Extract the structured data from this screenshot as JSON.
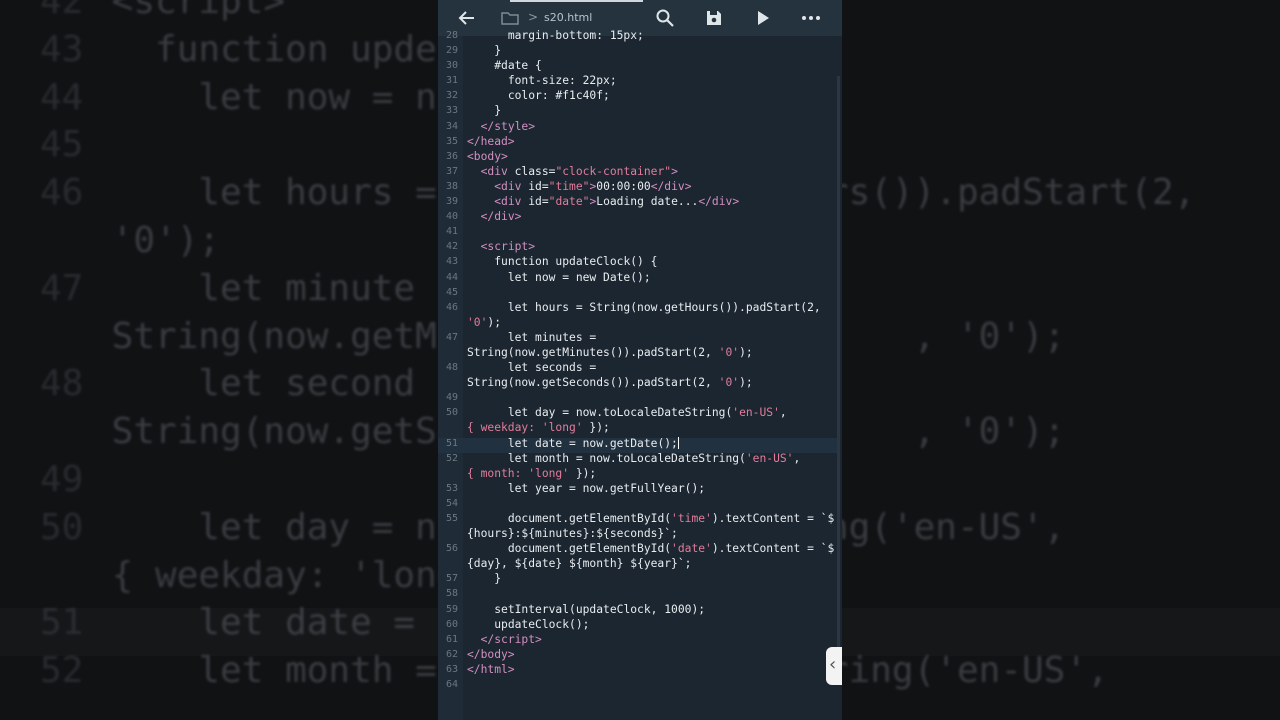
{
  "toolbar": {
    "filename": "s20.html",
    "icons": [
      "back-arrow-icon",
      "folder-icon",
      "search-icon",
      "save-icon",
      "play-icon",
      "more-icon"
    ]
  },
  "editor": {
    "lines": [
      {
        "n": "28",
        "html": "      margin-bottom: 15px;"
      },
      {
        "n": "29",
        "html": "    }"
      },
      {
        "n": "30",
        "html": "    #date {"
      },
      {
        "n": "31",
        "html": "      font-size: 22px;"
      },
      {
        "n": "32",
        "html": "      color: #f1c40f;"
      },
      {
        "n": "33",
        "html": "    }"
      },
      {
        "n": "34",
        "html": "  <span class='c-tag'>&lt;/style&gt;</span>"
      },
      {
        "n": "35",
        "html": "<span class='c-tag'>&lt;/head&gt;</span>"
      },
      {
        "n": "36",
        "html": "<span class='c-tag'>&lt;body&gt;</span>"
      },
      {
        "n": "37",
        "html": "  <span class='c-tag'>&lt;div</span> class=<span class='c-str'>\"clock-container\"</span><span class='c-tag'>&gt;</span>"
      },
      {
        "n": "38",
        "html": "    <span class='c-tag'>&lt;div</span> id=<span class='c-str'>\"time\"</span><span class='c-tag'>&gt;</span>00:00:00<span class='c-tag'>&lt;/div&gt;</span>"
      },
      {
        "n": "39",
        "html": "    <span class='c-tag'>&lt;div</span> id=<span class='c-str'>\"date\"</span><span class='c-tag'>&gt;</span>Loading date...<span class='c-tag'>&lt;/div&gt;</span>"
      },
      {
        "n": "40",
        "html": "  <span class='c-tag'>&lt;/div&gt;</span>"
      },
      {
        "n": "41",
        "html": ""
      },
      {
        "n": "42",
        "html": "  <span class='c-tag'>&lt;script&gt;</span>"
      },
      {
        "n": "43",
        "html": "    function updateClock() {"
      },
      {
        "n": "44",
        "html": "      let now = new Date();"
      },
      {
        "n": "45",
        "html": ""
      },
      {
        "n": "46",
        "tall": true,
        "html": "      let hours = String(now.getHours()).padStart(2,\n<span class='c-str'>'0'</span>);"
      },
      {
        "n": "47",
        "tall": true,
        "html": "      let minutes =\nString(now.getMinutes()).padStart(2, <span class='c-str'>'0'</span>);"
      },
      {
        "n": "48",
        "tall": true,
        "html": "      let seconds =\nString(now.getSeconds()).padStart(2, <span class='c-str'>'0'</span>);"
      },
      {
        "n": "49",
        "html": ""
      },
      {
        "n": "50",
        "tall": true,
        "html": "      let day = now.toLocaleDateString(<span class='c-str'>'en-US'</span>,\n<span class='c-str'>{ weekday: 'long'</span> });"
      },
      {
        "n": "51",
        "html": "      let date = now.getDate();<span class='cursor'></span>"
      },
      {
        "n": "52",
        "tall": true,
        "html": "      let month = now.toLocaleDateString(<span class='c-str'>'en-US'</span>,\n<span class='c-str'>{ month: 'long'</span> });"
      },
      {
        "n": "53",
        "html": "      let year = now.getFullYear();"
      },
      {
        "n": "54",
        "html": ""
      },
      {
        "n": "55",
        "tall": true,
        "html": "      document.getElementById(<span class='c-str'>'time'</span>).textContent = `$\n{hours}:${minutes}:${seconds}`;"
      },
      {
        "n": "56",
        "tall": true,
        "html": "      document.getElementById(<span class='c-str'>'date'</span>).textContent = `$\n{day}, ${date} ${month} ${year}`;"
      },
      {
        "n": "57",
        "html": "    }"
      },
      {
        "n": "58",
        "html": ""
      },
      {
        "n": "59",
        "html": "    setInterval(updateClock, 1000);"
      },
      {
        "n": "60",
        "html": "    updateClock();"
      },
      {
        "n": "61",
        "html": "  <span class='c-tag'>&lt;/script&gt;</span>"
      },
      {
        "n": "62",
        "html": "<span class='c-tag'>&lt;/body&gt;</span>"
      },
      {
        "n": "63",
        "html": "<span class='c-tag'>&lt;/html&gt;</span>"
      },
      {
        "n": "64",
        "html": ""
      }
    ]
  },
  "background": {
    "lines": [
      {
        "n": "42",
        "t": "<script>"
      },
      {
        "n": "43",
        "t": "  function upde"
      },
      {
        "n": "44",
        "t": "    let now = n"
      },
      {
        "n": "45",
        "t": ""
      },
      {
        "n": "46",
        "t": "    let hours =                  rs()).padStart(2,"
      },
      {
        "n": "",
        "t": "'0');"
      },
      {
        "n": "47",
        "t": "    let minute"
      },
      {
        "n": "",
        "t": "String(now.getMi                     , '0');"
      },
      {
        "n": "48",
        "t": "    let second"
      },
      {
        "n": "",
        "t": "String(now.getSe                     , '0');"
      },
      {
        "n": "49",
        "t": ""
      },
      {
        "n": "50",
        "t": "    let day = n                 ing('en-US',"
      },
      {
        "n": "",
        "t": "{ weekday: 'long"
      },
      {
        "n": "51",
        "t": "    let date ="
      },
      {
        "n": "52",
        "t": "    let month =                 tring('en-US',"
      }
    ]
  }
}
